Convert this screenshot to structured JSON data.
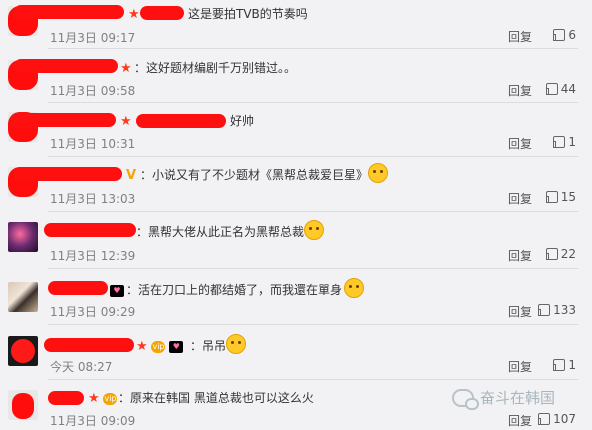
{
  "comments": [
    {
      "text": "这是要拍TVB的节奏吗",
      "time": "11月3日 09:17",
      "reply": "回复",
      "likes": "6"
    },
    {
      "text": "：这好题材编剧千万别错过。。",
      "time": "11月3日 09:58",
      "reply": "回复",
      "likes": "44"
    },
    {
      "text": "好帅",
      "time": "11月3日 10:31",
      "reply": "回复",
      "likes": "1"
    },
    {
      "text": "：小说又有了不少题材《黑帮总裁爱巨星》",
      "time": "11月3日 13:03",
      "reply": "回复",
      "likes": "15"
    },
    {
      "text": "：黑帮大佬从此正名为黑帮总裁",
      "time": "11月3日 12:39",
      "reply": "回复",
      "likes": "22"
    },
    {
      "text": "：活在刀口上的都结婚了，而我還在單身",
      "time": "11月3日 09:29",
      "reply": "回复",
      "likes": "133"
    },
    {
      "text": "：吊吊",
      "time": "今天 08:27",
      "reply": "回复",
      "likes": "1"
    },
    {
      "text": "：原来在韩国 黑道总裁也可以这么火",
      "time": "11月3日 09:09",
      "reply": "回复",
      "likes": "107"
    }
  ],
  "watermark": {
    "text": "奋斗在韩国",
    "icon": "wechat-icon"
  },
  "badges": {
    "star": "★",
    "v": "V",
    "vip": "vip",
    "mini": "♥"
  },
  "colors": {
    "redaction": "#ff1010",
    "background": "#f2f2f5",
    "star": "#ff3b1d"
  }
}
